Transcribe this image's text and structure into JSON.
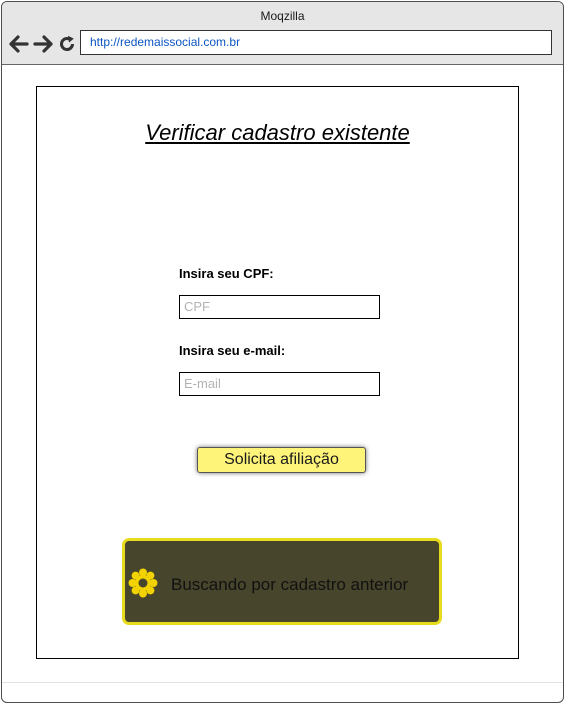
{
  "browser": {
    "window_title": "Moqzilla",
    "url": "http://redemaissocial.com.br",
    "icons": [
      "back-arrow-icon",
      "forward-arrow-icon",
      "reload-icon"
    ]
  },
  "page": {
    "title": "Verificar cadastro existente",
    "cpf": {
      "label": "Insira seu CPF:",
      "placeholder": "CPF"
    },
    "email": {
      "label": "Insira seu e-mail:",
      "placeholder": "E-mail"
    },
    "submit_label": "Solicita afiliação",
    "status": {
      "icon": "spinner-icon",
      "message": "Buscando por cadastro anterior"
    }
  },
  "colors": {
    "button_fill": "#fff47a",
    "status_fill": "#47452b",
    "status_border": "#e6dc1d",
    "spinner": "#f2d200",
    "link": "#0b55c4"
  }
}
